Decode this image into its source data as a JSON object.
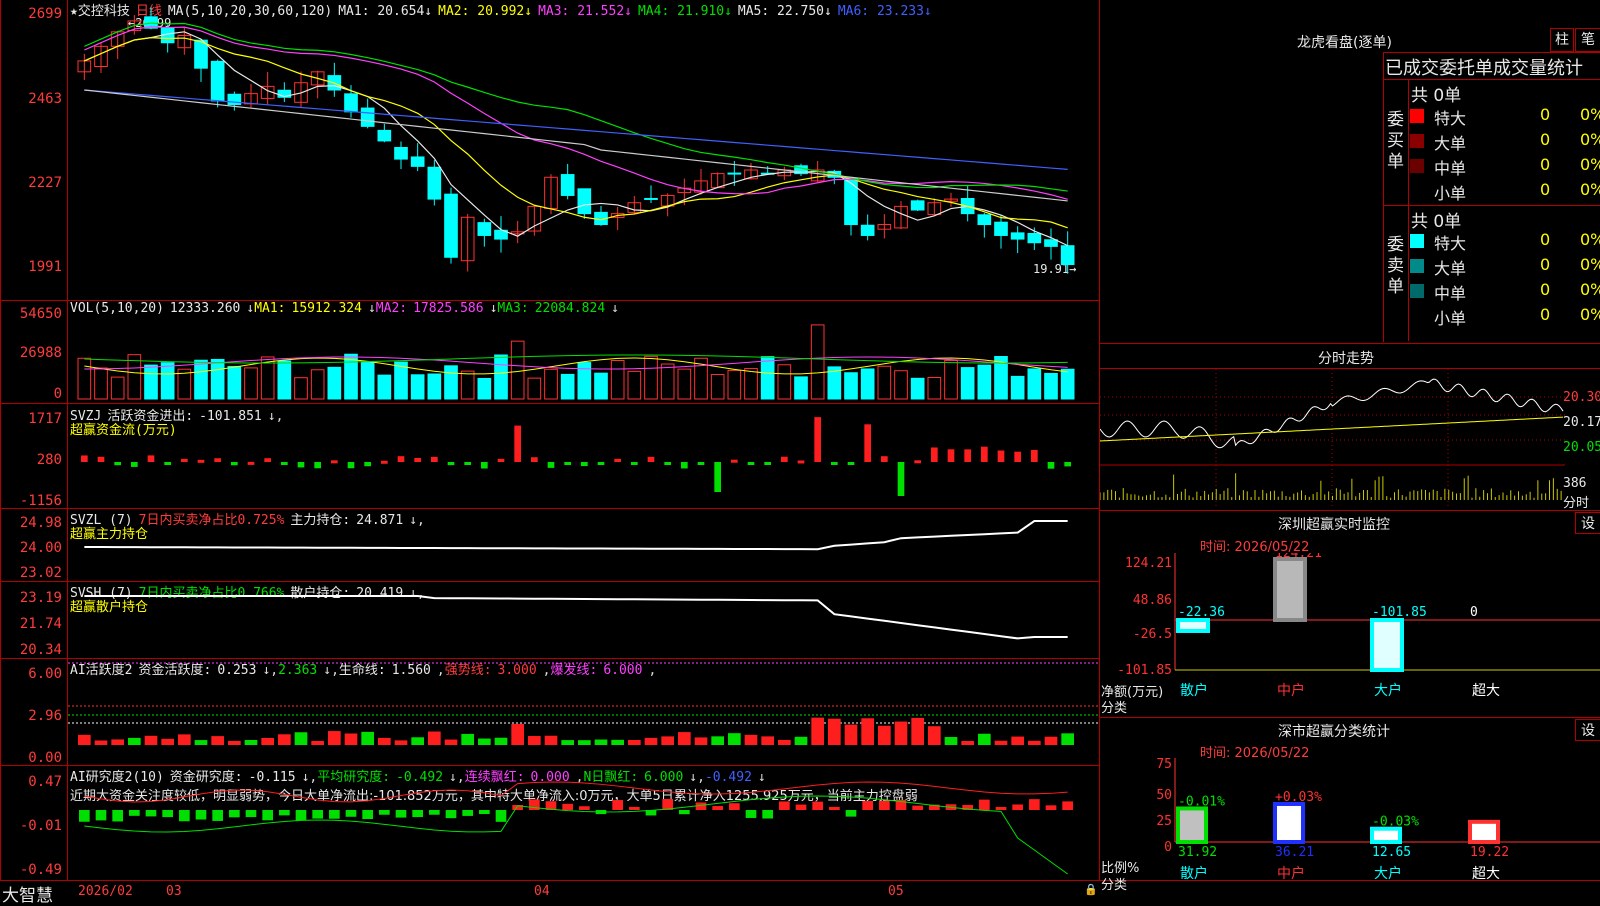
{
  "stock": {
    "title": "★交控科技",
    "period": "日线",
    "ma_label": "MA(5,10,20,30,60,120)",
    "ma": [
      {
        "k": "MA1:",
        "v": "20.654",
        "c": "c-w"
      },
      {
        "k": "MA2:",
        "v": "20.992",
        "c": "c-y"
      },
      {
        "k": "MA3:",
        "v": "21.552",
        "c": "c-m"
      },
      {
        "k": "MA4:",
        "v": "21.910",
        "c": "c-g"
      },
      {
        "k": "MA5:",
        "v": "22.750",
        "c": "c-w"
      },
      {
        "k": "MA6:",
        "v": "23.233",
        "c": "c-b"
      }
    ],
    "y_ticks": [
      "2699",
      "2463",
      "2227",
      "1991"
    ],
    "high_marker": "26.99",
    "low_marker": "19.91"
  },
  "vol": {
    "label": "VOL(5,10,20)",
    "val": "12333.260",
    "ma1": "15912.324",
    "ma2": "17825.586",
    "ma3": "22084.824",
    "y_ticks": [
      "54650",
      "26988",
      "0"
    ]
  },
  "svzj": {
    "label": "SVZJ",
    "text": "活跃资金进出:",
    "val": "-101.851",
    "sub": "超赢资金流(万元)",
    "y_ticks": [
      "1717",
      "280",
      "-1156"
    ]
  },
  "svzl": {
    "label": "SVZL (7)",
    "l1": "7日内买卖净占比0.725%",
    "l2": "主力持仓:",
    "v2": "24.871",
    "sub": "超赢主力持仓",
    "y_ticks": [
      "24.98",
      "24.00",
      "23.02"
    ]
  },
  "svsh": {
    "label": "SVSH (7)",
    "l1": "7日内买卖净占比0.766%",
    "l2": "散户持仓:",
    "v2": "20.419",
    "sub": "超赢散户持仓",
    "y_ticks": [
      "23.19",
      "21.74",
      "20.34"
    ]
  },
  "ai1": {
    "label": "AI活跃度2",
    "t1": "资金活跃度:",
    "v1": "0.253",
    "v1b": "2.363",
    "t2": "生命线:",
    "v2": "1.560",
    "t3": "强势线:",
    "v3": "3.000",
    "t4": "爆发线:",
    "v4": "6.000",
    "y_ticks": [
      "6.00",
      "2.96",
      "0.00"
    ]
  },
  "ai2": {
    "label": "AI研究度2(10)",
    "t1": "资金研究度:",
    "v1": "-0.115",
    "t2": "平均研究度:",
    "v2": "-0.492",
    "t3": "连续飘红:",
    "v3": "0.000",
    "t4": "N日飘红:",
    "v4": "6.000",
    "v5": "-0.492",
    "note": "近期大资金关注度较低，明显弱势，今日大单净流出:-101.852万元，其中特大单净流入:0万元，大单5日累计净入1255.925万元，当前主力控盘弱",
    "y_ticks": [
      "0.47",
      "-0.01",
      "-0.49"
    ]
  },
  "bottom": {
    "brand": "大智慧",
    "dates": [
      "2026/02",
      "03",
      "04",
      "05"
    ]
  },
  "longhu": {
    "title": "龙虎看盘(逐单)",
    "btn1": "柱",
    "btn2": "笔",
    "subtitle": "已成交委托单成交量统计",
    "buy_label": "委买单",
    "sell_label": "委卖单",
    "buy_total": "共 0单",
    "sell_total": "共 0单",
    "buy": [
      {
        "l": "特大",
        "n": "0",
        "p": "0%",
        "c": "#ff0000"
      },
      {
        "l": "大单",
        "n": "0",
        "p": "0%",
        "c": "#8a0000"
      },
      {
        "l": "中单",
        "n": "0",
        "p": "0%",
        "c": "#6a0000"
      },
      {
        "l": "小单",
        "n": "0",
        "p": "0%",
        "c": "#000"
      }
    ],
    "sell": [
      {
        "l": "特大",
        "n": "0",
        "p": "0%",
        "c": "#00ffff"
      },
      {
        "l": "大单",
        "n": "0",
        "p": "0%",
        "c": "#008a8a"
      },
      {
        "l": "中单",
        "n": "0",
        "p": "0%",
        "c": "#006a6a"
      },
      {
        "l": "小单",
        "n": "0",
        "p": "0%",
        "c": "#000"
      }
    ]
  },
  "intraday": {
    "title": "分时走势",
    "y": [
      "20.30",
      "20.17",
      "20.05"
    ],
    "vol": "386",
    "vol_unit": "分时"
  },
  "monitor": {
    "title": "深圳超赢实时监控",
    "btn": "设",
    "time": "时间: 2026/05/22",
    "y": [
      "124.21",
      "48.86",
      "-26.5",
      "-101.85"
    ],
    "ylabel": "净额(万元)",
    "xlabel": "分类",
    "vals": [
      "-22.36",
      "124.21",
      "-101.85",
      "0"
    ],
    "cats": [
      "散户",
      "中户",
      "大户",
      "超大"
    ]
  },
  "stats": {
    "title": "深市超赢分类统计",
    "btn": "设",
    "time": "时间: 2026/05/22",
    "y": [
      "75",
      "50",
      "25",
      "0"
    ],
    "ylabel": "比例%",
    "xlabel": "分类",
    "chg": [
      "-0.01%",
      "+0.03%",
      "-0.03%",
      ""
    ],
    "vals": [
      "31.92",
      "36.21",
      "12.65",
      "19.22"
    ],
    "cats": [
      "散户",
      "中户",
      "大户",
      "超大"
    ]
  }
}
